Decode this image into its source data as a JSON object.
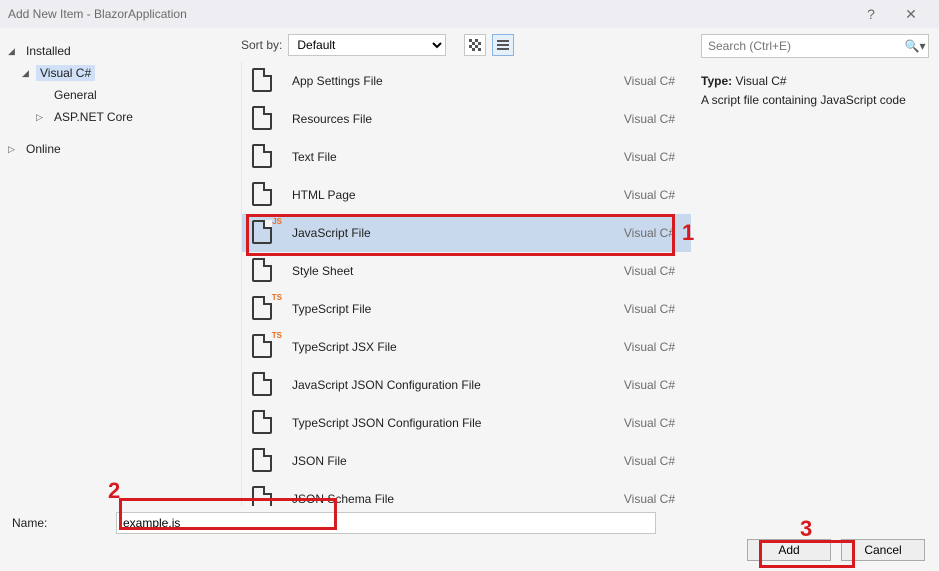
{
  "window": {
    "title": "Add New Item - BlazorApplication",
    "help": "?",
    "close": "✕"
  },
  "sidebar": {
    "installed": "Installed",
    "csharp": "Visual C#",
    "general": "General",
    "aspnet": "ASP.NET Core",
    "online": "Online"
  },
  "sort": {
    "label": "Sort by:",
    "value": "Default"
  },
  "templates": [
    {
      "name": "App Settings File",
      "lang": "Visual C#",
      "badge": ""
    },
    {
      "name": "Resources File",
      "lang": "Visual C#",
      "badge": ""
    },
    {
      "name": "Text File",
      "lang": "Visual C#",
      "badge": ""
    },
    {
      "name": "HTML Page",
      "lang": "Visual C#",
      "badge": ""
    },
    {
      "name": "JavaScript File",
      "lang": "Visual C#",
      "badge": "JS",
      "selected": true
    },
    {
      "name": "Style Sheet",
      "lang": "Visual C#",
      "badge": ""
    },
    {
      "name": "TypeScript File",
      "lang": "Visual C#",
      "badge": "TS"
    },
    {
      "name": "TypeScript JSX File",
      "lang": "Visual C#",
      "badge": "TS"
    },
    {
      "name": "JavaScript JSON Configuration File",
      "lang": "Visual C#",
      "badge": ""
    },
    {
      "name": "TypeScript JSON Configuration File",
      "lang": "Visual C#",
      "badge": ""
    },
    {
      "name": "JSON File",
      "lang": "Visual C#",
      "badge": ""
    },
    {
      "name": "JSON Schema File",
      "lang": "Visual C#",
      "badge": ""
    }
  ],
  "search": {
    "placeholder": "Search (Ctrl+E)",
    "icon": "🔍"
  },
  "detail": {
    "type_label": "Type:",
    "type_value": "Visual C#",
    "description": "A script file containing JavaScript code"
  },
  "footer": {
    "name_label": "Name:",
    "name_value": "example.js",
    "add": "Add",
    "cancel": "Cancel"
  },
  "callouts": {
    "n1": "1",
    "n2": "2",
    "n3": "3"
  }
}
